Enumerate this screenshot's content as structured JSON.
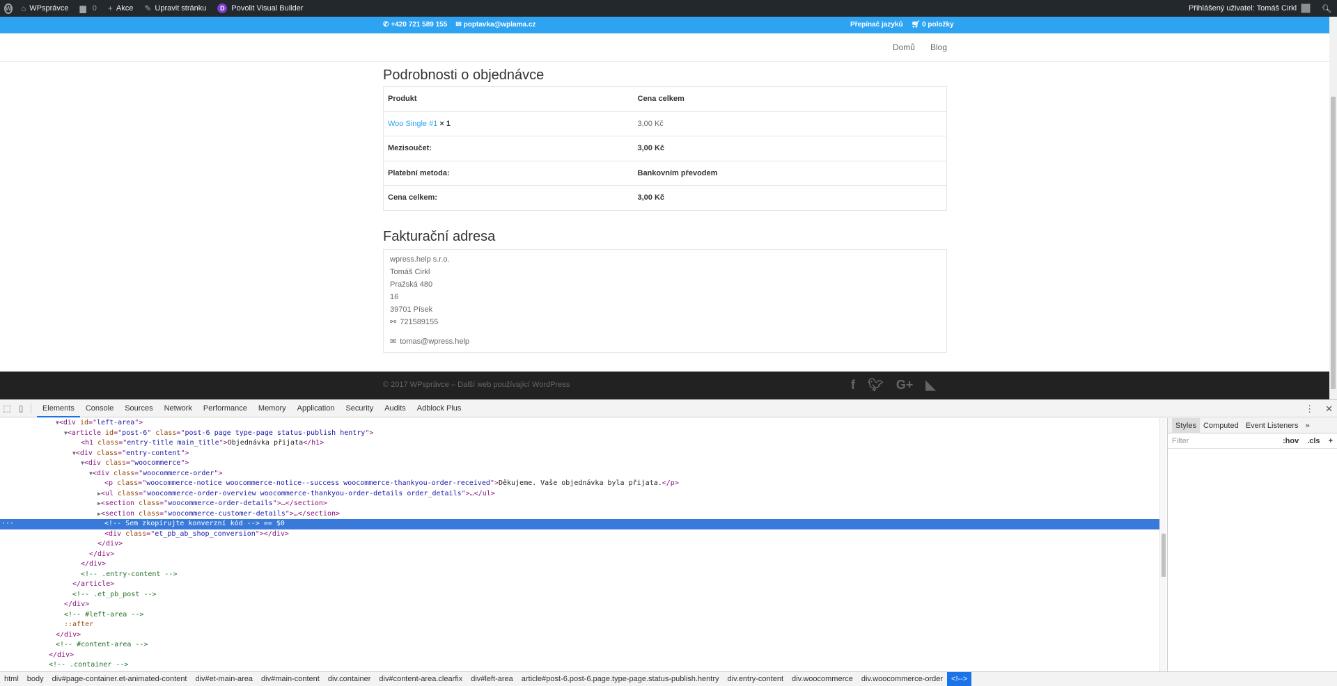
{
  "adminbar": {
    "site_name": "WPsprávce",
    "comments_count": "0",
    "new_label": "Akce",
    "edit_label": "Upravit stránku",
    "builder_label": "Povolit Visual Builder",
    "user_label": "Přihlášený uživatel: Tomáš Cirkl"
  },
  "topbar": {
    "phone": "+420 721 589 155",
    "email": "poptavka@wplama.cz",
    "lang_switch": "Přepínač jazyků",
    "cart": "0 položky"
  },
  "nav": {
    "items": [
      "Domů",
      "Blog"
    ]
  },
  "order_details": {
    "title": "Podrobnosti o objednávce",
    "header": {
      "product": "Produkt",
      "total": "Cena celkem"
    },
    "item": {
      "name": "Woo Single #1",
      "qty": "× 1",
      "price": "3,00 Kč"
    },
    "rows": [
      {
        "label": "Mezisoučet:",
        "value": "3,00 Kč"
      },
      {
        "label": "Platební metoda:",
        "value": "Bankovním převodem"
      },
      {
        "label": "Cena celkem:",
        "value": "3,00 Kč"
      }
    ]
  },
  "billing": {
    "title": "Fakturační adresa",
    "company": "wpress.help s.r.o.",
    "name": "Tomáš Cirkl",
    "street": "Pražská 480",
    "street2": "16",
    "city": "39701 Písek",
    "phone": "721589155",
    "email": "tomas@wpress.help"
  },
  "footer": {
    "credit": "© 2017 WPsprávce – Další web používající WordPress"
  },
  "devtools": {
    "tabs": [
      "Elements",
      "Console",
      "Sources",
      "Network",
      "Performance",
      "Memory",
      "Application",
      "Security",
      "Audits",
      "Adblock Plus"
    ],
    "active_tab": "Elements",
    "styles_tabs": [
      "Styles",
      "Computed",
      "Event Listeners"
    ],
    "filter_placeholder": "Filter",
    "filter_hov": ":hov",
    "filter_cls": ".cls",
    "breadcrumbs": [
      "html",
      "body",
      "div#page-container.et-animated-content",
      "div#et-main-area",
      "div#main-content",
      "div.container",
      "div#content-area.clearfix",
      "div#left-area",
      "article#post-6.post-6.page.type-page.status-publish.hentry",
      "div.entry-content",
      "div.woocommerce",
      "div.woocommerce-order",
      "<!-->"
    ]
  },
  "colors": {
    "accent": "#2ea3f2",
    "adminbar": "#23282d",
    "footer": "#222222",
    "selection": "#3879d9"
  },
  "icons": [
    "wordpress-icon",
    "comment-icon",
    "plus-icon",
    "pencil-icon",
    "divi-icon",
    "search-icon",
    "phone-icon",
    "mail-icon",
    "cart-icon",
    "link-icon",
    "facebook-icon",
    "twitter-icon",
    "google-plus-icon",
    "rss-icon",
    "inspect-icon",
    "device-icon",
    "more-icon",
    "close-icon"
  ]
}
